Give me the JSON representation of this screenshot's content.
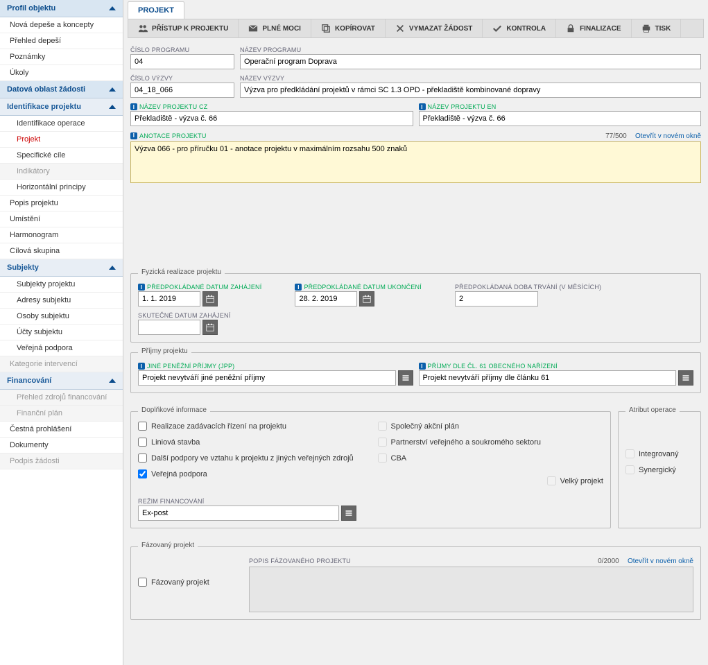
{
  "sidebar": {
    "profile_header": "Profil objektu",
    "profile_items": [
      "Nová depeše a koncepty",
      "Přehled depeší",
      "Poznámky",
      "Úkoly"
    ],
    "data_header": "Datová oblast žádosti",
    "ident_header": "Identifikace projektu",
    "ident_items": {
      "operace": "Identifikace operace",
      "projekt": "Projekt",
      "cile": "Specifické cíle",
      "indikatory": "Indikátory",
      "principy": "Horizontální principy"
    },
    "mid_items": {
      "popis": "Popis projektu",
      "umisteni": "Umístění",
      "harmonogram": "Harmonogram",
      "cilova": "Cílová skupina"
    },
    "subj_header": "Subjekty",
    "subj_items": {
      "proj": "Subjekty projektu",
      "adresy": "Adresy subjektu",
      "osoby": "Osoby subjektu",
      "ucty": "Účty subjektu",
      "podpora": "Veřejná podpora"
    },
    "kat": "Kategorie intervencí",
    "fin_header": "Financování",
    "fin_items": {
      "zdroje": "Přehled zdrojů financování",
      "plan": "Finanční plán"
    },
    "bottom": {
      "cestna": "Čestná prohlášení",
      "dok": "Dokumenty",
      "podpis": "Podpis žádosti"
    }
  },
  "tab_title": "PROJEKT",
  "toolbar": {
    "pristup": "PŘÍSTUP K PROJEKTU",
    "plne": "PLNÉ MOCI",
    "kopirovat": "KOPÍROVAT",
    "vymazat": "VYMAZAT ŽÁDOST",
    "kontrola": "KONTROLA",
    "finalizace": "FINALIZACE",
    "tisk": "TISK"
  },
  "labels": {
    "cislo_prog": "ČÍSLO PROGRAMU",
    "nazev_prog": "NÁZEV PROGRAMU",
    "cislo_vyzvy": "ČÍSLO VÝZVY",
    "nazev_vyzvy": "NÁZEV VÝZVY",
    "nazev_proj_cz": "NÁZEV PROJEKTU CZ",
    "nazev_proj_en": "NÁZEV PROJEKTU EN",
    "anotace": "ANOTACE PROJEKTU",
    "fyzicka": "Fyzická realizace projektu",
    "dat_zahajeni": "PŘEDPOKLÁDANÉ DATUM ZAHÁJENÍ",
    "dat_ukonceni": "PŘEDPOKLÁDANÉ DATUM UKONČENÍ",
    "doba": "PŘEDPOKLÁDANÁ DOBA TRVÁNÍ (V MĚSÍCÍCH)",
    "skut_zahajeni": "SKUTEČNÉ DATUM ZAHÁJENÍ",
    "prijmy": "Příjmy projektu",
    "jpp": "JINÉ PENĚŽNÍ PŘÍJMY (JPP)",
    "prijmy61": "PŘÍJMY DLE ČL. 61 OBECNÉHO NAŘÍZENÍ",
    "doplnkove": "Doplňkové informace",
    "atribut": "Atribut operace",
    "rezim": "REŽIM FINANCOVÁNÍ",
    "fazovany": "Fázovaný projekt",
    "popis_faz": "POPIS FÁZOVANÉHO PROJEKTU"
  },
  "values": {
    "cislo_prog": "04",
    "nazev_prog": "Operační program Doprava",
    "cislo_vyzvy": "04_18_066",
    "nazev_vyzvy": "Výzva pro předkládání projektů v rámci SC 1.3 OPD - překladiště kombinované dopravy",
    "nazev_proj_cz": "Překladiště - výzva č. 66",
    "nazev_proj_en": "Překladiště - výzva č. 66",
    "anotace": "Výzva 066 - pro příručku 01 - anotace projektu v maximálním rozsahu 500 znaků",
    "anotace_counter": "77/500",
    "otevrit": "Otevřít v novém okně",
    "dat_zahajeni": "1. 1. 2019",
    "dat_ukonceni": "28. 2. 2019",
    "doba": "2",
    "skut_zahajeni": "",
    "jpp": "Projekt nevytváří jiné peněžní příjmy",
    "prijmy61": "Projekt nevytváří příjmy dle článku 61",
    "rezim": "Ex-post",
    "faz_counter": "0/2000",
    "popis_faz": ""
  },
  "checks": {
    "realizace": "Realizace zadávacích řízení na projektu",
    "liniova": "Liniová stavba",
    "dalsi": "Další podpory ve vztahu k projektu z jiných veřejných zdrojů",
    "verejna": "Veřejná podpora",
    "akcni": "Společný akční plán",
    "partnerstvi": "Partnerství veřejného a soukromého sektoru",
    "cba": "CBA",
    "velky": "Velký projekt",
    "integrovany": "Integrovaný",
    "synergicky": "Synergický",
    "fazovany": "Fázovaný projekt"
  }
}
